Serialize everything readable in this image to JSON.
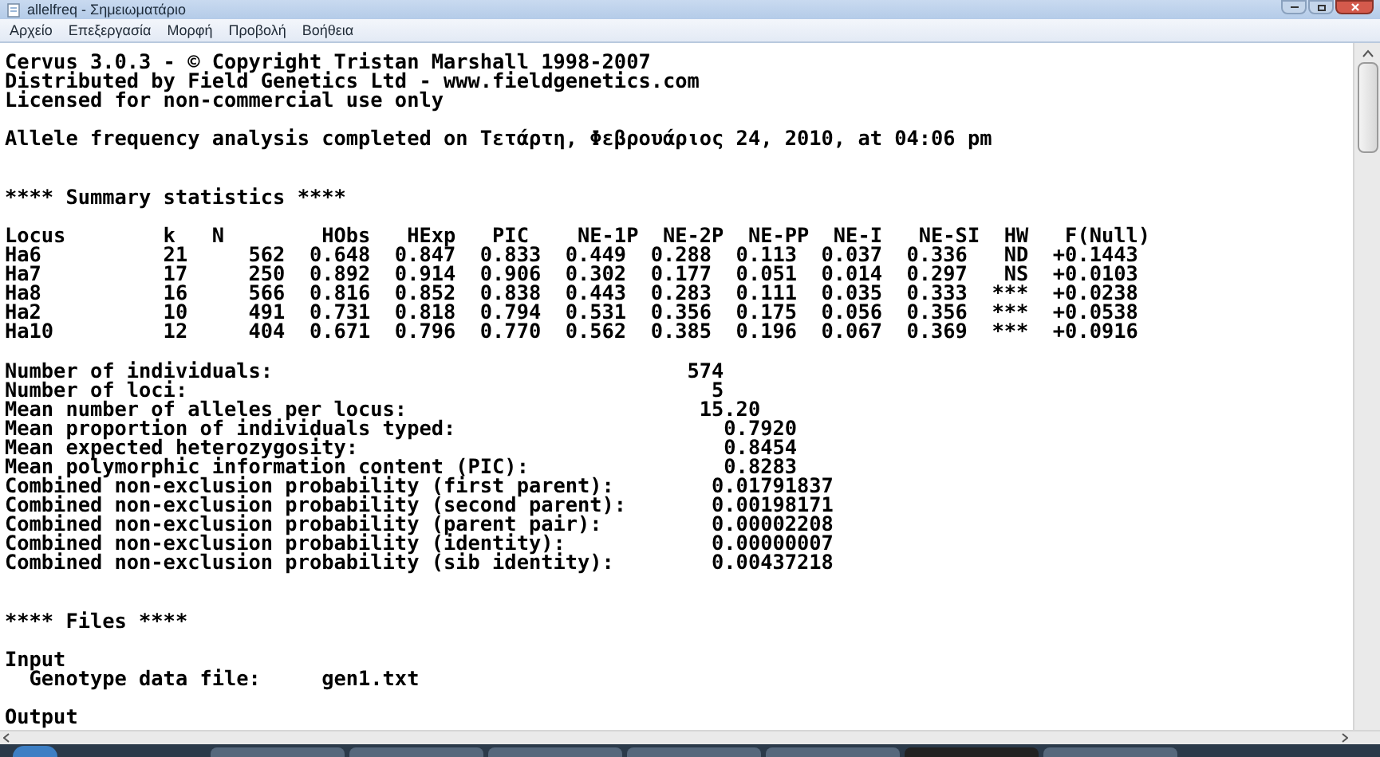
{
  "window": {
    "title": "allelfreq - Σημειωματάριο"
  },
  "menu": [
    "Αρχείο",
    "Επεξεργασία",
    "Μορφή",
    "Προβολή",
    "Βοήθεια"
  ],
  "document": {
    "lines": [
      {
        "kind": "text",
        "text": "Cervus 3.0.3 - © Copyright Tristan Marshall 1998-2007"
      },
      {
        "kind": "text",
        "text": "Distributed by Field Genetics Ltd - www.fieldgenetics.com"
      },
      {
        "kind": "text",
        "text": "Licensed for non-commercial use only"
      },
      {
        "kind": "blank"
      },
      {
        "kind": "text",
        "text": "Allele frequency analysis completed on Τετάρτη, Φεβρουάριος 24, 2010, at 04:06 pm"
      },
      {
        "kind": "blank"
      },
      {
        "kind": "blank"
      },
      {
        "kind": "text",
        "text": "**** Summary statistics ****"
      },
      {
        "kind": "blank"
      },
      {
        "kind": "text",
        "text": "Locus        k   N        HObs   HExp   PIC    NE-1P  NE-2P  NE-PP  NE-I   NE-SI  HW   F(Null)"
      },
      {
        "kind": "text",
        "text": "Ha6          21     562  0.648  0.847  0.833  0.449  0.288  0.113  0.037  0.336   ND  +0.1443"
      },
      {
        "kind": "text",
        "text": "Ha7          17     250  0.892  0.914  0.906  0.302  0.177  0.051  0.014  0.297   NS  +0.0103"
      },
      {
        "kind": "text",
        "text": "Ha8          16     566  0.816  0.852  0.838  0.443  0.283  0.111  0.035  0.333  ***  +0.0238"
      },
      {
        "kind": "text",
        "text": "Ha2          10     491  0.731  0.818  0.794  0.531  0.356  0.175  0.056  0.356  ***  +0.0538"
      },
      {
        "kind": "text",
        "text": "Ha10         12     404  0.671  0.796  0.770  0.562  0.385  0.196  0.067  0.369  ***  +0.0916"
      },
      {
        "kind": "blank"
      },
      {
        "kind": "text",
        "text": "Number of individuals:                                  574"
      },
      {
        "kind": "text",
        "text": "Number of loci:                                           5"
      },
      {
        "kind": "text",
        "text": "Mean number of alleles per locus:                        15.20"
      },
      {
        "kind": "text",
        "text": "Mean proportion of individuals typed:                      0.7920"
      },
      {
        "kind": "text",
        "text": "Mean expected heterozygosity:                              0.8454"
      },
      {
        "kind": "text",
        "text": "Mean polymorphic information content (PIC):                0.8283"
      },
      {
        "kind": "text",
        "text": "Combined non-exclusion probability (first parent):        0.01791837"
      },
      {
        "kind": "text",
        "text": "Combined non-exclusion probability (second parent):       0.00198171"
      },
      {
        "kind": "text",
        "text": "Combined non-exclusion probability (parent pair):         0.00002208"
      },
      {
        "kind": "text",
        "text": "Combined non-exclusion probability (identity):            0.00000007"
      },
      {
        "kind": "text",
        "text": "Combined non-exclusion probability (sib identity):        0.00437218"
      },
      {
        "kind": "blank"
      },
      {
        "kind": "blank"
      },
      {
        "kind": "text",
        "text": "**** Files ****"
      },
      {
        "kind": "blank"
      },
      {
        "kind": "text",
        "text": "Input"
      },
      {
        "kind": "text",
        "text": "  Genotype data file:     gen1.txt"
      },
      {
        "kind": "blank"
      },
      {
        "kind": "text",
        "text": "Output"
      }
    ]
  }
}
